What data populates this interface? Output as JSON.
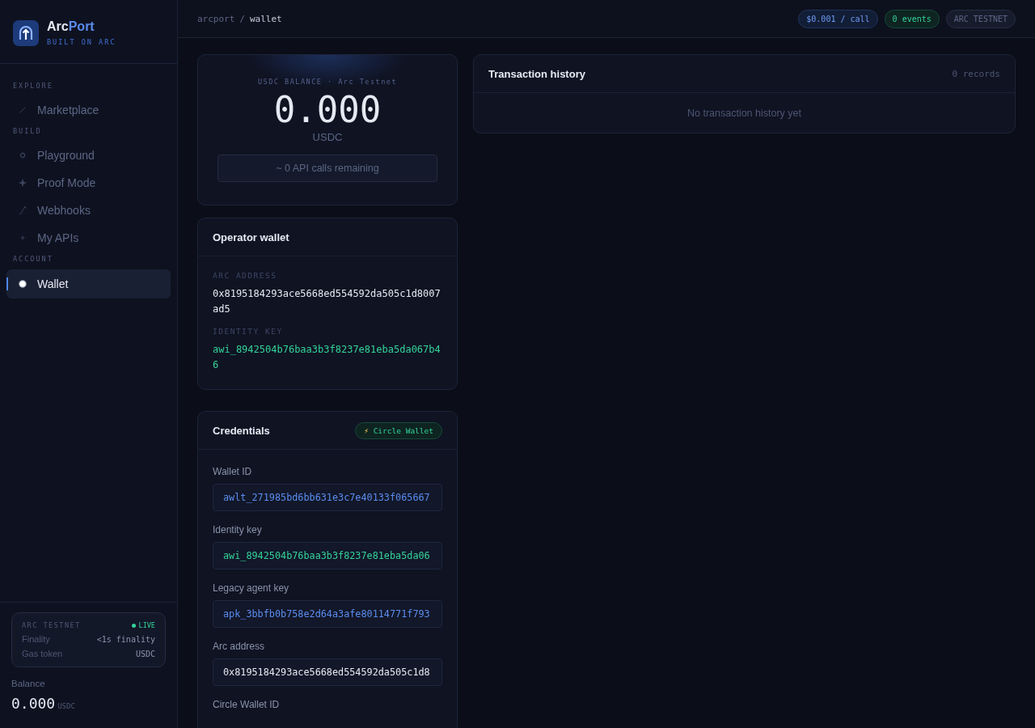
{
  "brand": {
    "name_a": "Arc",
    "name_b": "Port",
    "tagline": "BUILT ON ARC"
  },
  "nav": [
    {
      "section": "EXPLORE",
      "items": [
        {
          "label": "Marketplace",
          "selected": false
        }
      ]
    },
    {
      "section": "BUILD",
      "items": [
        {
          "label": "Playground",
          "selected": false
        },
        {
          "label": "Proof Mode",
          "selected": false
        },
        {
          "label": "Webhooks",
          "selected": false
        },
        {
          "label": "My APIs",
          "selected": false
        }
      ]
    },
    {
      "section": "ACCOUNT",
      "items": [
        {
          "label": "Wallet",
          "selected": true
        }
      ]
    }
  ],
  "network_card": {
    "title": "ARC TESTNET",
    "status": "LIVE",
    "rows": [
      {
        "label": "Finality",
        "value": "<1s finality"
      },
      {
        "label": "Gas token",
        "value": "USDC"
      }
    ]
  },
  "sidebar_balance": {
    "label": "Balance",
    "amount": "0.000",
    "unit": "USDC"
  },
  "breadcrumb": {
    "root": "arcport",
    "sep": "/",
    "current": "wallet"
  },
  "pills": [
    {
      "kind": "price",
      "text": "$0.001 / call"
    },
    {
      "kind": "events",
      "text": "0 events"
    },
    {
      "kind": "network",
      "text": "ARC TESTNET"
    }
  ],
  "balance_card": {
    "caption": "USDC BALANCE · Arc Testnet",
    "amount": "0.000",
    "unit": "USDC",
    "remaining": "~ 0 API calls remaining"
  },
  "operator_wallet": {
    "title": "Operator wallet",
    "fields": [
      {
        "label": "ARC ADDRESS",
        "value": "0x8195184293ace5668ed554592da505c1d8007ad5",
        "color": "#e6e9f2"
      },
      {
        "label": "IDENTITY KEY",
        "value": "awi_8942504b76baa3b3f8237e81eba5da067b46",
        "color": "#34d399"
      }
    ]
  },
  "credentials": {
    "title": "Credentials",
    "badge_icon": "⚡",
    "badge": "Circle Wallet",
    "fields": [
      {
        "label": "Wallet ID",
        "value": "awlt_271985bd6bb631e3c7e40133f065667",
        "color": "#5b8def"
      },
      {
        "label": "Identity key",
        "value": "awi_8942504b76baa3b3f8237e81eba5da06",
        "color": "#34d399"
      },
      {
        "label": "Legacy agent key",
        "value": "apk_3bbfb0b758e2d64a3afe80114771f793",
        "color": "#5b8def"
      },
      {
        "label": "Arc address",
        "value": "0x8195184293ace5668ed554592da505c1d8",
        "color": "#e6e9f2"
      },
      {
        "label": "Circle Wallet ID"
      }
    ]
  },
  "transactions": {
    "title": "Transaction history",
    "count": "0 records",
    "empty": "No transaction history yet"
  }
}
